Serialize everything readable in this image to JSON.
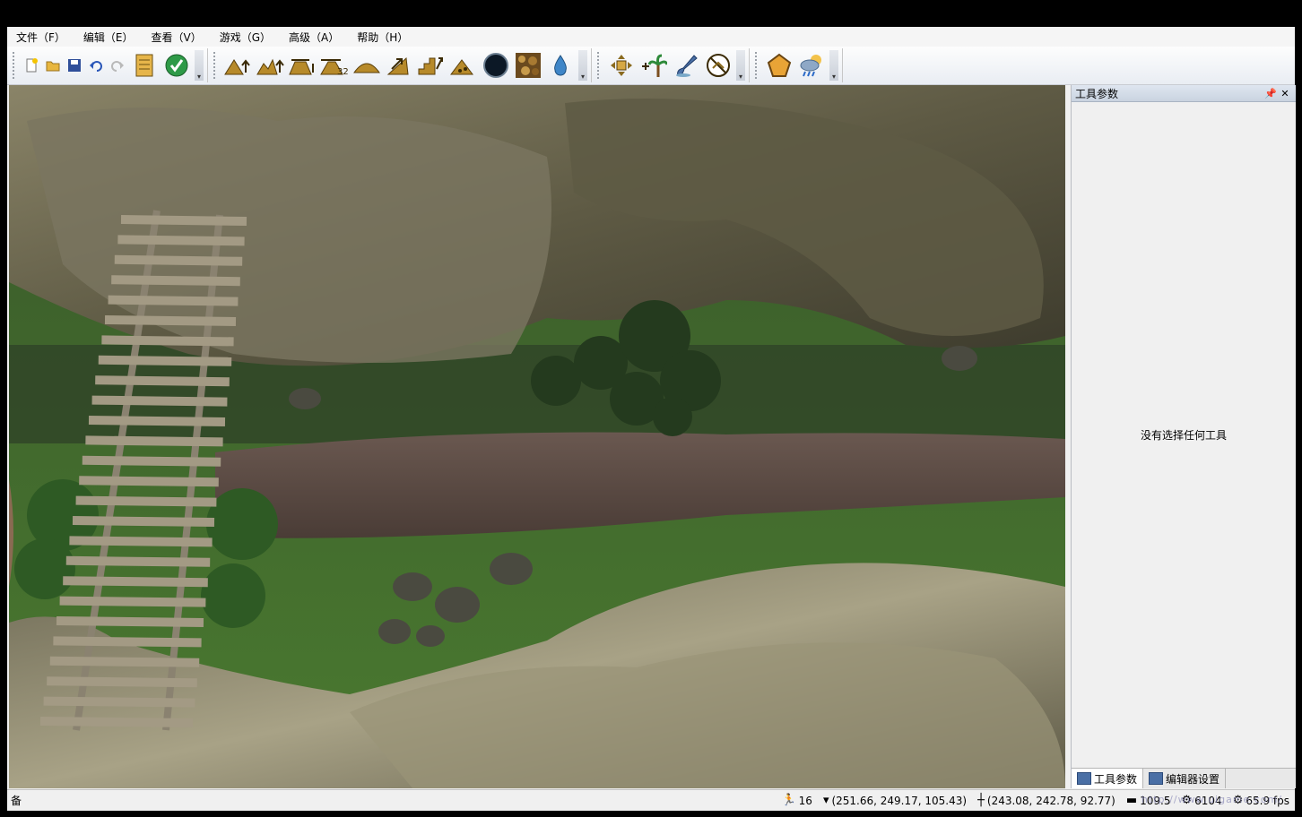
{
  "menu": {
    "items": [
      "文件（F）",
      "编辑（E）",
      "查看（V）",
      "游戏（G）",
      "高级（A）",
      "帮助（H）"
    ]
  },
  "toolbar": {
    "groups": [
      {
        "name": "file",
        "buttons": [
          "new-file-icon",
          "open-folder-icon",
          "save-icon",
          "undo-icon",
          "redo-icon",
          "notes-icon",
          "checkmark-icon"
        ]
      },
      {
        "name": "terrain",
        "buttons": [
          "raise-terrain-icon",
          "raise-terrain-alt-icon",
          "flatten-terrain-icon",
          "terrain-32-icon",
          "smooth-terrain-icon",
          "ramp-terrain-icon",
          "stairs-terrain-icon",
          "erode-terrain-icon",
          "hole-icon",
          "texture-icon",
          "water-drop-icon"
        ]
      },
      {
        "name": "objects",
        "buttons": [
          "move-object-icon",
          "add-vegetation-icon",
          "paint-brush-icon",
          "no-tool-icon"
        ]
      },
      {
        "name": "environment",
        "buttons": [
          "polygon-icon",
          "weather-icon"
        ]
      }
    ],
    "terrain_label": "32"
  },
  "panel": {
    "title": "工具参数",
    "empty_message": "没有选择任何工具",
    "tabs": [
      {
        "label": "工具参数",
        "active": true
      },
      {
        "label": "编辑器设置",
        "active": false
      }
    ]
  },
  "status": {
    "left_text": "备",
    "speed": "16",
    "cursor_position": "(251.66, 249.17, 105.43)",
    "camera_position": "(243.08, 242.78, 92.77)",
    "distance": "109.5",
    "objects": "6104",
    "fps": "65.9 fps",
    "watermark": "http://www.uigame.com/"
  },
  "colors": {
    "accent": "#4a6fa5",
    "panel_header": "#c9d3e0",
    "grass": "#3f6b2a",
    "road": "#5a4a42",
    "rock": "#7a7560"
  }
}
